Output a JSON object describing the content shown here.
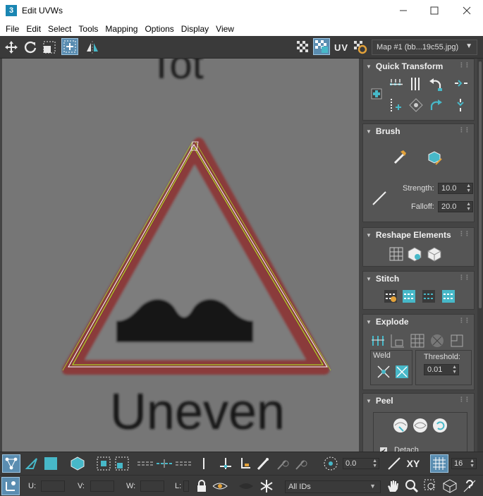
{
  "window": {
    "app_icon": "3",
    "title": "Edit UVWs",
    "minimize_icon": "minimize-icon",
    "maximize_icon": "maximize-icon",
    "close_icon": "close-icon"
  },
  "menu": [
    "File",
    "Edit",
    "Select",
    "Tools",
    "Mapping",
    "Options",
    "Display",
    "View"
  ],
  "toolbar": {
    "uv_label": "UV",
    "map_dropdown": "Map #1 (bb...19c55.jpg)"
  },
  "viewport": {
    "texture_top_text": "Tot",
    "texture_bottom_text": "Uneven",
    "colors": {
      "sign_red": "#8a3a3a",
      "background": "#767676",
      "uv_edge": "#b4f020"
    }
  },
  "panels": {
    "quick_transform": {
      "title": "Quick Transform"
    },
    "brush": {
      "title": "Brush",
      "strength_label": "Strength:",
      "strength_value": "10.0",
      "falloff_label": "Falloff:",
      "falloff_value": "20.0"
    },
    "reshape": {
      "title": "Reshape Elements"
    },
    "stitch": {
      "title": "Stitch"
    },
    "explode": {
      "title": "Explode",
      "weld_label": "Weld",
      "threshold_label": "Threshold:",
      "threshold_value": "0.01"
    },
    "peel": {
      "title": "Peel",
      "detach_label": "Detach"
    }
  },
  "bottom": {
    "rotate_value": "0.0",
    "xy_label": "XY",
    "grid_value": "16",
    "u_label": "U:",
    "v_label": "V:",
    "w_label": "W:",
    "l_label": "L:",
    "ids_dropdown": "All IDs"
  },
  "accent_color": "#5a8db1"
}
